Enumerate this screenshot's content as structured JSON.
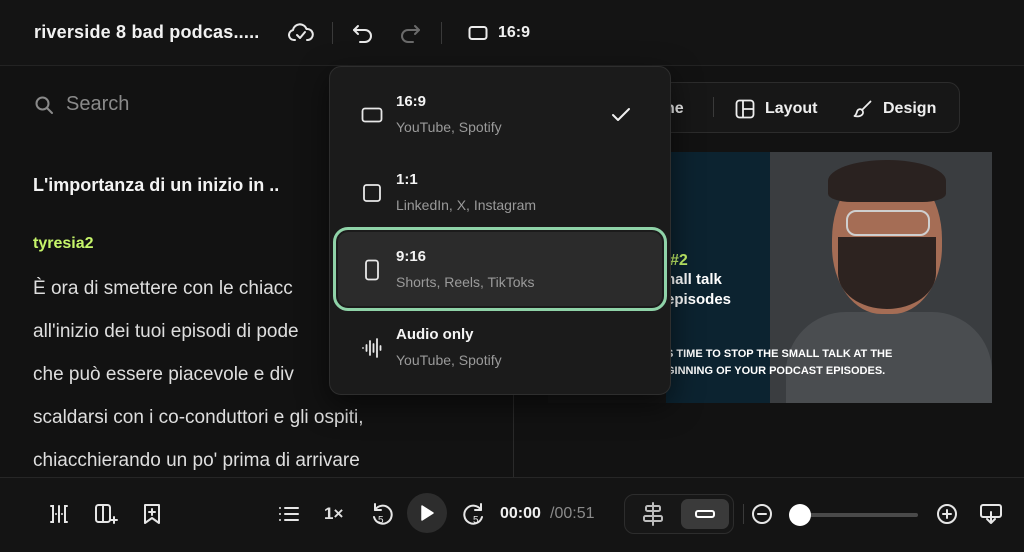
{
  "header": {
    "title": "riverside 8 bad podcas.....",
    "aspect_label": "16:9",
    "icons": [
      "cloud-sync-icon",
      "undo-icon",
      "redo-icon",
      "aspect-ratio-icon"
    ]
  },
  "left": {
    "search_placeholder": "Search",
    "segment_title": "L'importanza di un inizio in  ..",
    "speaker": "tyresia2",
    "transcript_lines": [
      "È ora di smettere con le chiacc",
      "all'inizio dei tuoi episodi di pode",
      "che può essere piacevole e div",
      "scaldarsi con i co-conduttori e gli ospiti,",
      "chiacchierando un po' prima di arrivare"
    ]
  },
  "right_toolbar": {
    "partial_label": "ne",
    "layout_label": "Layout",
    "design_label": "Design"
  },
  "video": {
    "number": "#2",
    "headline_1": "nall talk",
    "headline_2": "episodes",
    "caption_1": "S TIME TO STOP THE SMALL TALK AT THE",
    "caption_2": "GINNING OF YOUR PODCAST EPISODES."
  },
  "dropdown": {
    "options": [
      {
        "title": "16:9",
        "subtitle": "YouTube, Spotify",
        "selected": true
      },
      {
        "title": "1:1",
        "subtitle": "LinkedIn, X, Instagram",
        "selected": false
      },
      {
        "title": "9:16",
        "subtitle": "Shorts, Reels, TikToks",
        "selected": false
      },
      {
        "title": "Audio only",
        "subtitle": "YouTube, Spotify",
        "selected": false
      }
    ]
  },
  "player": {
    "speed": "1×",
    "time_current": "00:00",
    "time_total": "/00:51",
    "skip_back": "5",
    "skip_forward": "5",
    "zoom_level": 0
  },
  "colors": {
    "accent_green": "#c6f56a",
    "highlight_outline": "#8fd3a8",
    "background": "#121212"
  }
}
